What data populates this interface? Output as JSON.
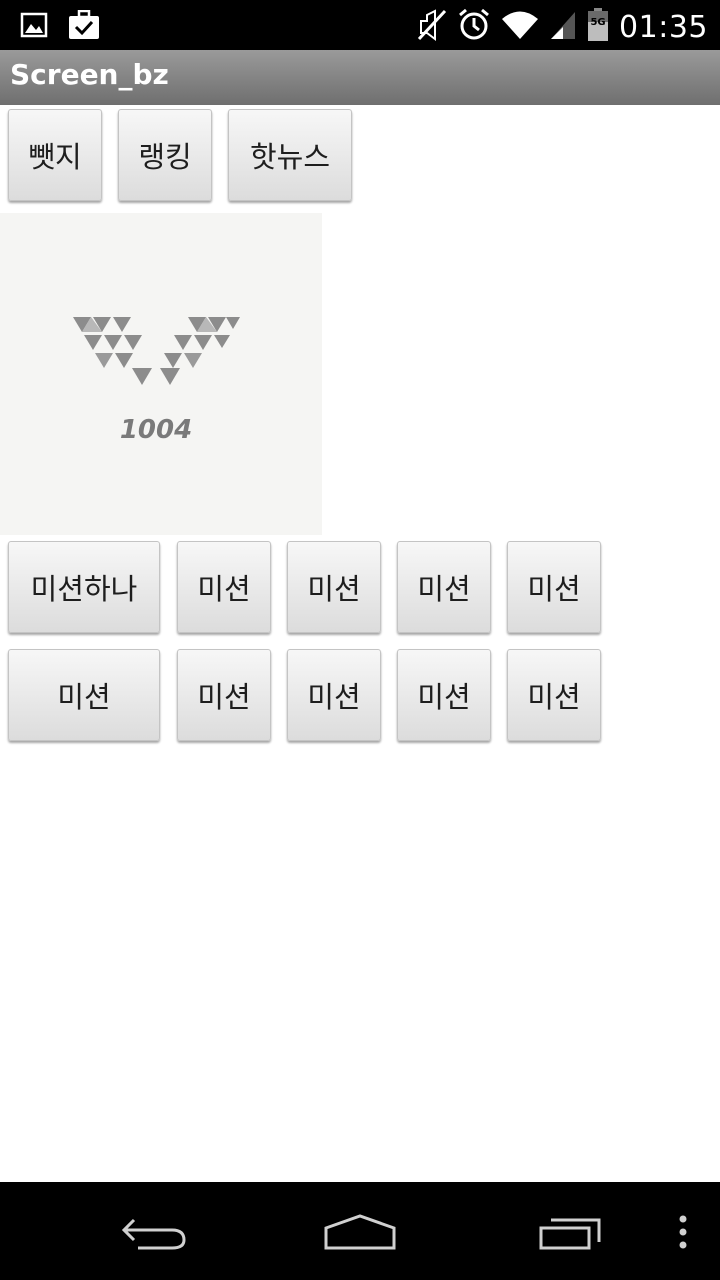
{
  "status_bar": {
    "time": "01:35",
    "signal_label": "5G"
  },
  "app": {
    "title": "Screen_bz"
  },
  "top_buttons": [
    {
      "label": "뺏지"
    },
    {
      "label": "랭킹"
    },
    {
      "label": "핫뉴스"
    }
  ],
  "logo": {
    "text": "1004",
    "icon": "triangle-v-logo"
  },
  "mission_rows": [
    [
      {
        "label": "미션하나"
      },
      {
        "label": "미션"
      },
      {
        "label": "미션"
      },
      {
        "label": "미션"
      },
      {
        "label": "미션"
      }
    ],
    [
      {
        "label": "미션"
      },
      {
        "label": "미션"
      },
      {
        "label": "미션"
      },
      {
        "label": "미션"
      },
      {
        "label": "미션"
      }
    ]
  ],
  "nav_bar": {
    "back_icon": "back-icon",
    "home_icon": "home-icon",
    "recents_icon": "recents-icon",
    "menu_icon": "overflow-menu-icon"
  },
  "colors": {
    "status_bar": "#000000",
    "title_bar": "#8a8a8a",
    "logo_gray": "#8c8c8c"
  }
}
